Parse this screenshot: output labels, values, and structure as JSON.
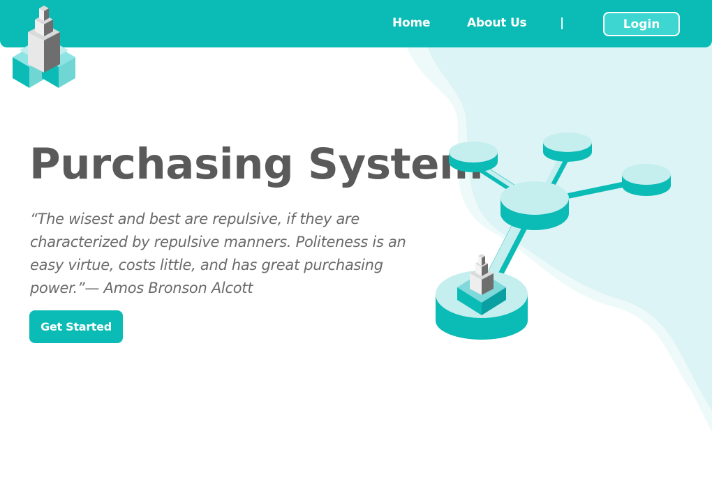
{
  "colors": {
    "brand": "#0bbbb6",
    "brand_light": "#3ed6d1",
    "pale": "#c5eeee",
    "title_text": "#5a5a5a",
    "quote_text": "#6a6a6a",
    "background": "#ffffff"
  },
  "header": {
    "logo_icon": "isometric-tower-logo",
    "nav": [
      {
        "label": "Home"
      },
      {
        "label": "About Us"
      }
    ],
    "separator": "|",
    "login_label": "Login"
  },
  "hero": {
    "title": "Purchasing System",
    "quote": "“The wisest and best are repulsive, if they are characterized by repulsive manners. Politeness is an easy virtue, costs little, and has great purchasing power.”— Amos Bronson Alcott",
    "cta_label": "Get Started",
    "illustration_icon": "network-nodes-illustration"
  }
}
